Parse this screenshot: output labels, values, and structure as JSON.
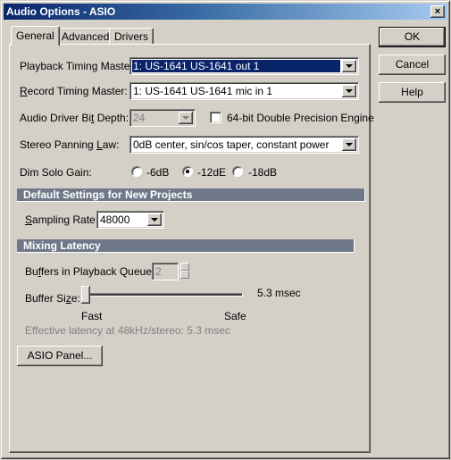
{
  "window": {
    "title": "Audio Options - ASIO",
    "close_label": "×"
  },
  "tabs": [
    {
      "label": "General",
      "active": true
    },
    {
      "label": "Advanced",
      "active": false
    },
    {
      "label": "Drivers",
      "active": false
    }
  ],
  "general": {
    "playback_timing_master": {
      "label": "Playback Timing Master:",
      "value": "1: US-1641 US-1641 out 1"
    },
    "record_timing_master": {
      "label_first": "R",
      "label_rest": "ecord Timing Master:",
      "value": "1: US-1641 US-1641 mic in 1"
    },
    "bit_depth": {
      "label_pre": "Audio Driver Bi",
      "label_ul": "t",
      "label_post": " Depth:",
      "value": "24",
      "disabled": true
    },
    "double_precision": {
      "label": "64-bit Double Precision Engine",
      "checked": false
    },
    "panning_law": {
      "label_pre": "Stereo Panning ",
      "label_ul": "L",
      "label_post": "aw:",
      "value": "0dB center, sin/cos taper, constant power"
    },
    "dim_solo_gain": {
      "label": "Dim Solo Gain:",
      "options": [
        {
          "label": "-6dB",
          "selected": false
        },
        {
          "label": "-12dE",
          "selected": true
        },
        {
          "label": "-18dB",
          "selected": false
        }
      ]
    },
    "defaults_section": {
      "title": "Default Settings for New Projects",
      "sampling_rate": {
        "label_ul": "S",
        "label_rest": "ampling Rate:",
        "value": "48000"
      }
    },
    "latency_section": {
      "title": "Mixing Latency",
      "buffers_queue": {
        "label_pre": "Bu",
        "label_ul": "f",
        "label_post": "fers in Playback Queue:",
        "value": "2",
        "disabled": true
      },
      "buffer_size": {
        "label_pre": "Buffer Si",
        "label_ul": "z",
        "label_post": "e:",
        "value_text": "5.3 msec",
        "slider_position": 0.0,
        "min_label": "Fast",
        "max_label": "Safe"
      },
      "effective_latency": "Effective latency at 48kHz/stereo:  5.3 msec"
    },
    "asio_panel_button": "ASIO Panel..."
  },
  "buttons": {
    "ok": "OK",
    "cancel": "Cancel",
    "help": "Help"
  }
}
